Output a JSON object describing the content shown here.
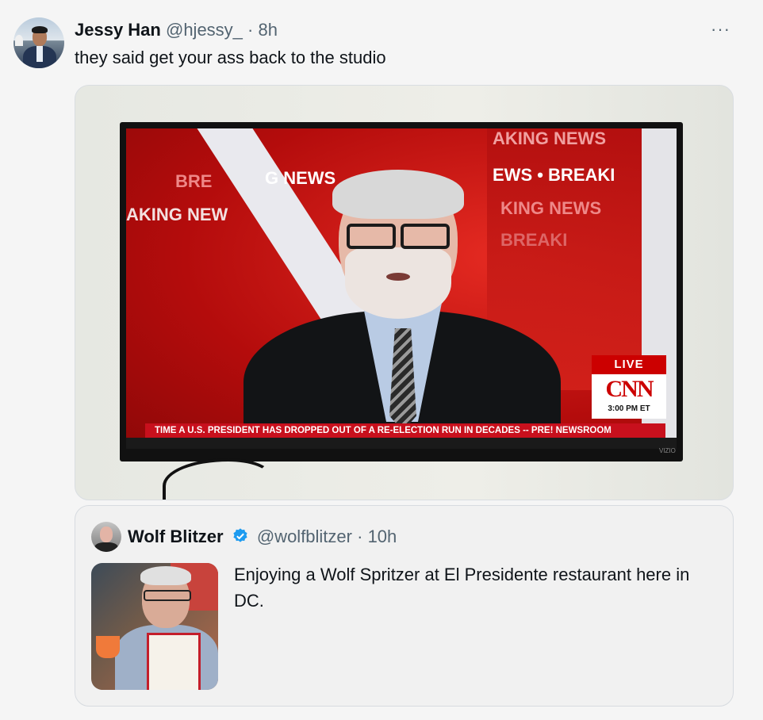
{
  "tweet": {
    "author_name": "Jessy Han",
    "author_handle": "@hjessy_",
    "separator": "·",
    "time": "8h",
    "more": "···",
    "text": "they said get your ass back to the studio",
    "media": {
      "breaking_texts": [
        "BRE",
        "AKING NEW",
        "G NEWS",
        "AKING NEWS",
        "EWS • BREAKI",
        "KING NEWS",
        "BREAKI"
      ],
      "live": "LIVE",
      "network": "CNN",
      "time": "3:00 PM ET",
      "lower_third": "TIME A U.S. PRESIDENT HAS DROPPED OUT OF A RE-ELECTION RUN IN DECADES -- PRE! NEWSROOM",
      "tv_brand": "VIZIO"
    }
  },
  "quoted": {
    "author_name": "Wolf Blitzer",
    "author_handle": "@wolfblitzer",
    "separator": "·",
    "time": "10h",
    "text": "Enjoying a Wolf Spritzer at El Presidente restaurant here in DC."
  },
  "colors": {
    "verified_badge": "#1d9bf0",
    "cnn_red": "#cc0000",
    "muted_text": "#536471"
  }
}
